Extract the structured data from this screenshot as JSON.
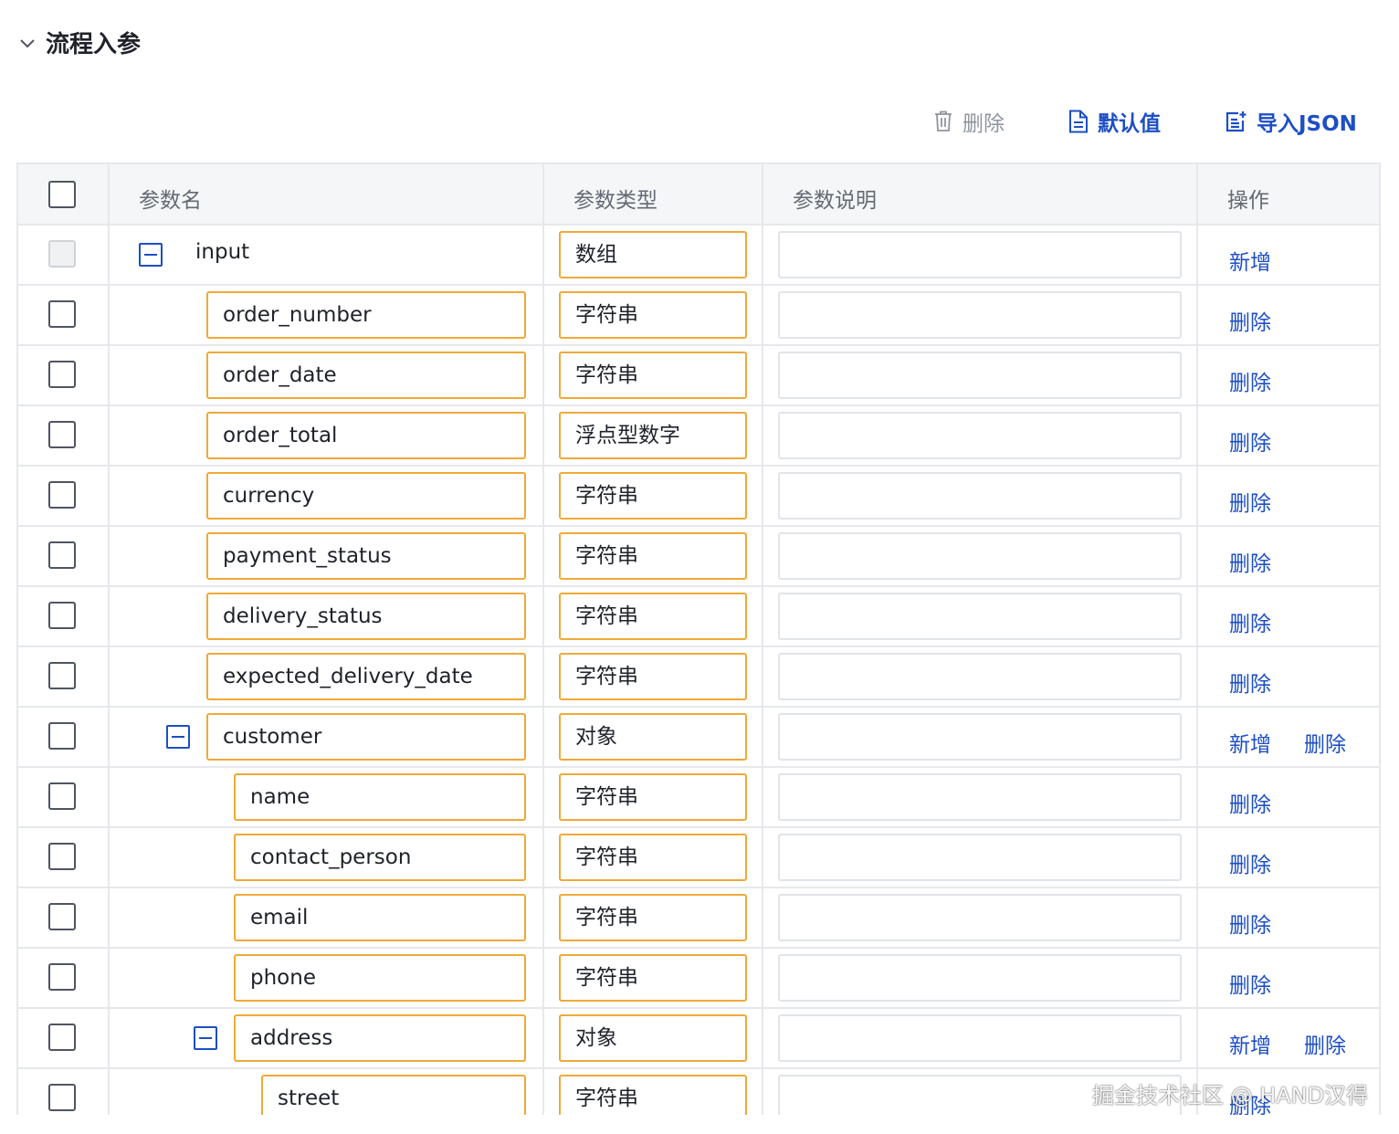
{
  "section": {
    "title": "流程入参"
  },
  "toolbar": {
    "delete_label": "删除",
    "default_label": "默认值",
    "import_label": "导入JSON"
  },
  "table": {
    "headers": {
      "name": "参数名",
      "type": "参数类型",
      "desc": "参数说明",
      "op": "操作"
    },
    "rows": [
      {
        "name": "input",
        "type": "数组",
        "desc": "",
        "depth": 0,
        "expandable": true,
        "editable_name": false,
        "checkbox_disabled": true,
        "actions": [
          "新增"
        ]
      },
      {
        "name": "order_number",
        "type": "字符串",
        "desc": "",
        "depth": 1,
        "expandable": false,
        "editable_name": true,
        "checkbox_disabled": false,
        "actions": [
          "删除"
        ]
      },
      {
        "name": "order_date",
        "type": "字符串",
        "desc": "",
        "depth": 1,
        "expandable": false,
        "editable_name": true,
        "checkbox_disabled": false,
        "actions": [
          "删除"
        ]
      },
      {
        "name": "order_total",
        "type": "浮点型数字",
        "desc": "",
        "depth": 1,
        "expandable": false,
        "editable_name": true,
        "checkbox_disabled": false,
        "actions": [
          "删除"
        ]
      },
      {
        "name": "currency",
        "type": "字符串",
        "desc": "",
        "depth": 1,
        "expandable": false,
        "editable_name": true,
        "checkbox_disabled": false,
        "actions": [
          "删除"
        ]
      },
      {
        "name": "payment_status",
        "type": "字符串",
        "desc": "",
        "depth": 1,
        "expandable": false,
        "editable_name": true,
        "checkbox_disabled": false,
        "actions": [
          "删除"
        ]
      },
      {
        "name": "delivery_status",
        "type": "字符串",
        "desc": "",
        "depth": 1,
        "expandable": false,
        "editable_name": true,
        "checkbox_disabled": false,
        "actions": [
          "删除"
        ]
      },
      {
        "name": "expected_delivery_date",
        "type": "字符串",
        "desc": "",
        "depth": 1,
        "expandable": false,
        "editable_name": true,
        "checkbox_disabled": false,
        "actions": [
          "删除"
        ]
      },
      {
        "name": "customer",
        "type": "对象",
        "desc": "",
        "depth": 1,
        "expandable": true,
        "editable_name": true,
        "checkbox_disabled": false,
        "actions": [
          "新增",
          "删除"
        ]
      },
      {
        "name": "name",
        "type": "字符串",
        "desc": "",
        "depth": 2,
        "expandable": false,
        "editable_name": true,
        "checkbox_disabled": false,
        "actions": [
          "删除"
        ]
      },
      {
        "name": "contact_person",
        "type": "字符串",
        "desc": "",
        "depth": 2,
        "expandable": false,
        "editable_name": true,
        "checkbox_disabled": false,
        "actions": [
          "删除"
        ]
      },
      {
        "name": "email",
        "type": "字符串",
        "desc": "",
        "depth": 2,
        "expandable": false,
        "editable_name": true,
        "checkbox_disabled": false,
        "actions": [
          "删除"
        ]
      },
      {
        "name": "phone",
        "type": "字符串",
        "desc": "",
        "depth": 2,
        "expandable": false,
        "editable_name": true,
        "checkbox_disabled": false,
        "actions": [
          "删除"
        ]
      },
      {
        "name": "address",
        "type": "对象",
        "desc": "",
        "depth": 2,
        "expandable": true,
        "editable_name": true,
        "checkbox_disabled": false,
        "actions": [
          "新增",
          "删除"
        ]
      },
      {
        "name": "street",
        "type": "字符串",
        "desc": "",
        "depth": 3,
        "expandable": false,
        "editable_name": true,
        "checkbox_disabled": false,
        "actions": [
          "删除"
        ]
      }
    ]
  },
  "watermark": "掘金技术社区 @ HAND汉得",
  "colors": {
    "accent": "#1d4fc4",
    "field_border": "#f0a938",
    "muted": "#8f959e"
  }
}
